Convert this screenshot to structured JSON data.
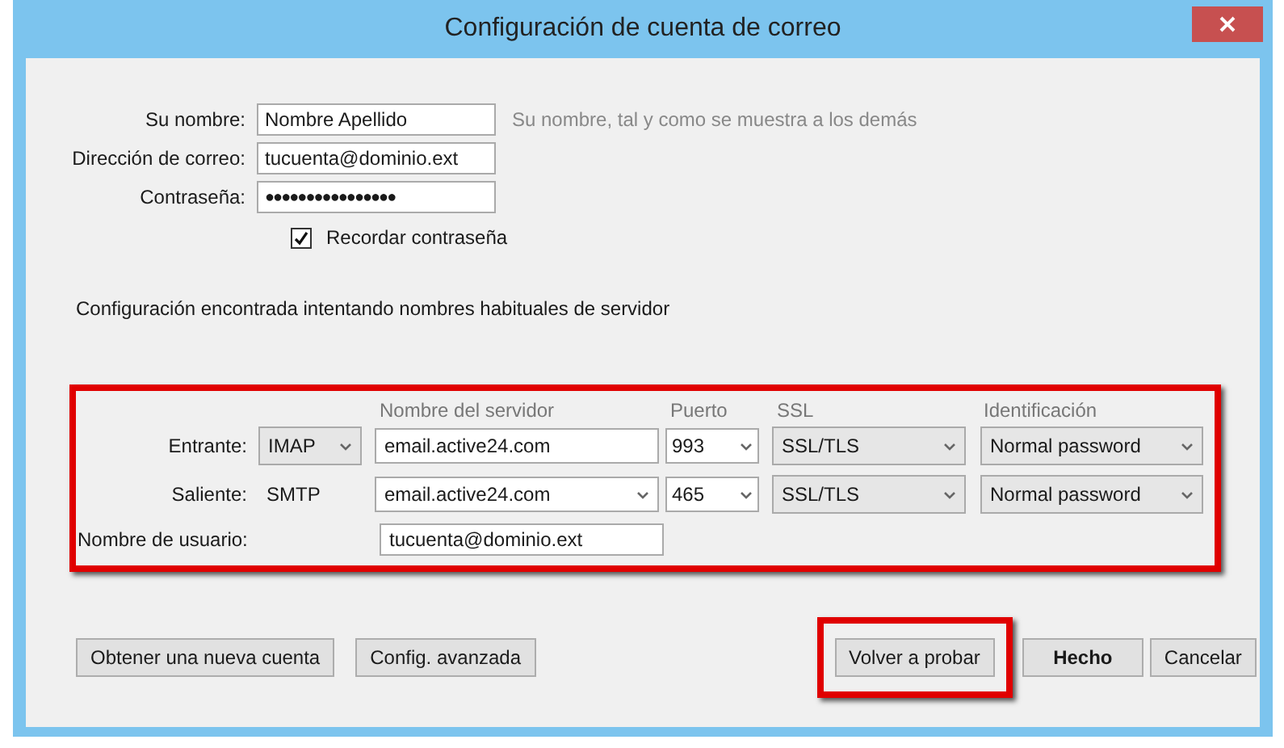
{
  "window": {
    "title": "Configuración de cuenta de correo"
  },
  "identity": [
    {
      "label": "Su nombre:",
      "value": "Nombre Apellido",
      "hint": "Su nombre, tal y como se muestra a los demás",
      "kind": "text"
    },
    {
      "label": "Dirección de correo:",
      "value": "tucuenta@dominio.ext",
      "kind": "text"
    },
    {
      "label": "Contraseña:",
      "value": "●●●●●●●●●●●●●●●●",
      "kind": "password"
    }
  ],
  "remember": {
    "label": "Recordar contraseña",
    "checked": true
  },
  "status": "Configuración encontrada intentando nombres habituales de servidor",
  "servers": {
    "columns": [
      "Nombre del servidor",
      "Puerto",
      "SSL",
      "Identificación"
    ],
    "rows": [
      {
        "label": "Entrante:",
        "protocol": {
          "text": "IMAP",
          "kind": "dropdown"
        },
        "server": {
          "text": "email.active24.com",
          "kind": "text"
        },
        "port": "993",
        "ssl": "SSL/TLS",
        "auth": "Normal password"
      },
      {
        "label": "Saliente:",
        "protocol": {
          "text": "SMTP",
          "kind": "static"
        },
        "server": {
          "text": "email.active24.com",
          "kind": "dropdown"
        },
        "port": "465",
        "ssl": "SSL/TLS",
        "auth": "Normal password"
      }
    ],
    "username": {
      "label": "Nombre de usuario:",
      "value": "tucuenta@dominio.ext"
    }
  },
  "buttons": [
    {
      "label": "Obtener una nueva cuenta",
      "default": false,
      "highlighted": false
    },
    {
      "label": "Config. avanzada",
      "default": false,
      "highlighted": false
    },
    {
      "label": "Volver a probar",
      "default": false,
      "highlighted": true
    },
    {
      "label": "Hecho",
      "default": true,
      "highlighted": false
    },
    {
      "label": "Cancelar",
      "default": false,
      "highlighted": false
    }
  ]
}
